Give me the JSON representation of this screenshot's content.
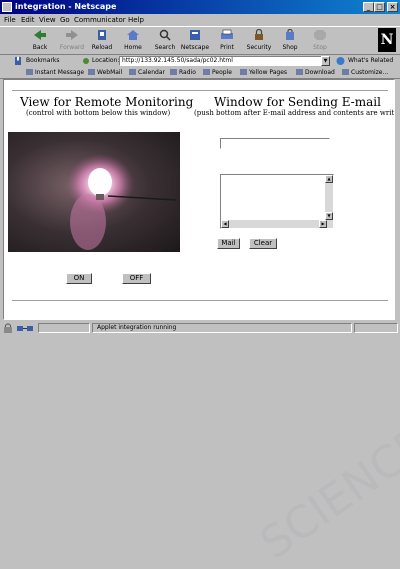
{
  "window": {
    "title": "integration - Netscape",
    "minimize": "_",
    "maximize": "□",
    "close": "×"
  },
  "menu": [
    "File",
    "Edit",
    "View",
    "Go",
    "Communicator",
    "Help"
  ],
  "toolbar": [
    {
      "label": "Back",
      "icon": "back-arrow-icon",
      "enabled": true
    },
    {
      "label": "Forward",
      "icon": "forward-arrow-icon",
      "enabled": false
    },
    {
      "label": "Reload",
      "icon": "reload-icon",
      "enabled": true
    },
    {
      "label": "Home",
      "icon": "home-icon",
      "enabled": true
    },
    {
      "label": "Search",
      "icon": "search-icon",
      "enabled": true
    },
    {
      "label": "Netscape",
      "icon": "netscape-icon",
      "enabled": true
    },
    {
      "label": "Print",
      "icon": "print-icon",
      "enabled": true
    },
    {
      "label": "Security",
      "icon": "security-icon",
      "enabled": true
    },
    {
      "label": "Shop",
      "icon": "shop-icon",
      "enabled": true
    },
    {
      "label": "Stop",
      "icon": "stop-icon",
      "enabled": false
    }
  ],
  "brand_logo": "N",
  "location": {
    "bookmarks_label": "Bookmarks",
    "location_label": "Location:",
    "url": "http://133.92.145.50/sada/pc02.html",
    "whats_related": "What's Related"
  },
  "personal_toolbar": [
    "Instant Message",
    "WebMail",
    "Calendar",
    "Radio",
    "People",
    "Yellow Pages",
    "Download",
    "Customize..."
  ],
  "page": {
    "left_heading": "View for Remote Monitoring",
    "left_sub": "(control with bottom below this window)",
    "right_heading": "Window for Sending E-mail",
    "right_sub": "(push bottom after E-mail address and contents are written)",
    "email_address": "",
    "email_body": "",
    "mail_button": "Mail",
    "clear_button": "Clear",
    "on_button": "ON",
    "off_button": "OFF"
  },
  "status": {
    "text": "Applet integration running"
  },
  "watermark": "SCIENCE AND TECHNOLOGY PUBLICATIONS",
  "colors": {
    "titlebar_start": "#000080",
    "titlebar_end": "#1084d0",
    "chrome": "#c0c0c0",
    "content_bg": "#ffffff"
  }
}
